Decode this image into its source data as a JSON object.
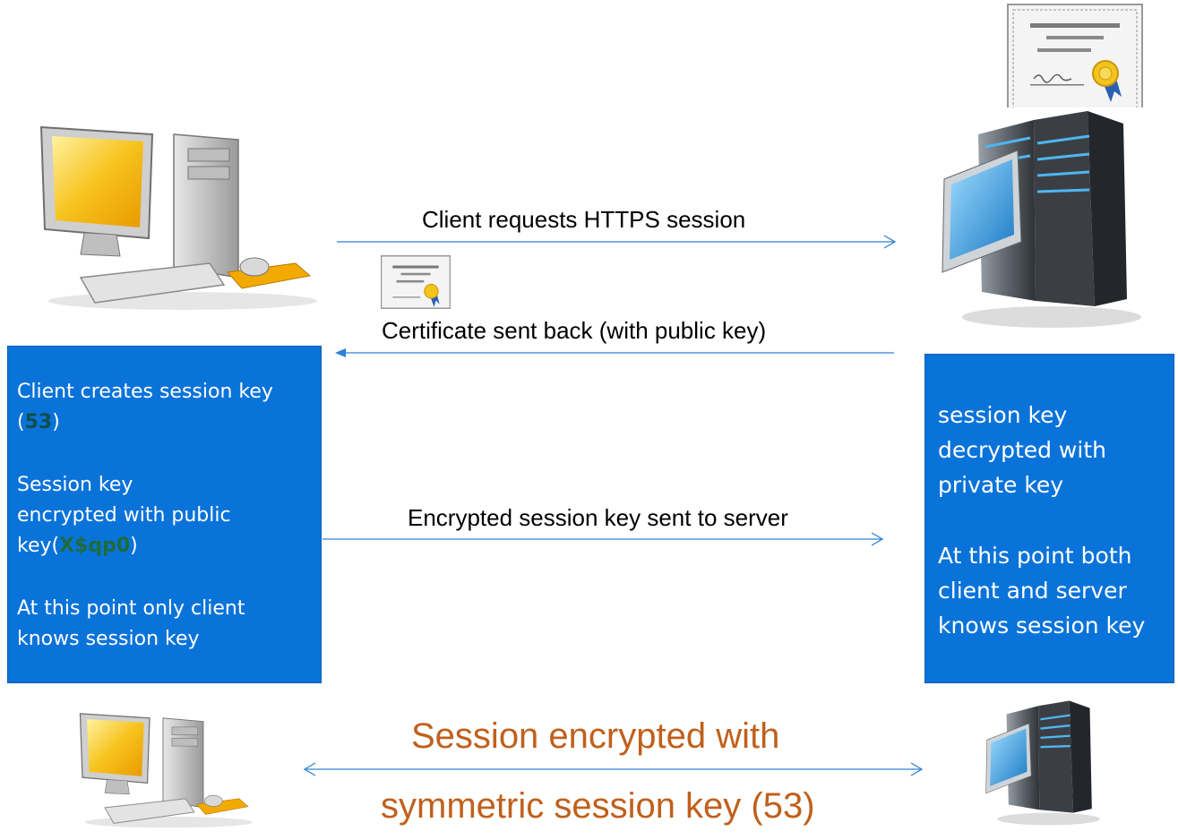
{
  "messages": {
    "request": "Client requests HTTPS session",
    "certificate": "Certificate sent back (with public key)",
    "encrypted_key": "Encrypted session key sent to server"
  },
  "client_box": {
    "line1": "Client creates session key",
    "key_open": "(",
    "key_value": "53",
    "key_close": ")",
    "line3": "Session key",
    "line4": "encrypted with public",
    "enc_prefix": "key(",
    "enc_value": "X$qp0",
    "enc_close": ")",
    "line6": "At this point only client",
    "line7": "knows session key"
  },
  "server_box": {
    "line1": "session key",
    "line2": "decrypted with",
    "line3": "private key",
    "line4": "At this point both",
    "line5": "client and server",
    "line6": "knows session key"
  },
  "final": {
    "line1": "Session  encrypted with",
    "line2": "symmetric session key (53)"
  },
  "colors": {
    "box": "#0a73d9",
    "arrow": "#2f80d6",
    "final_text": "#c0601c",
    "key_highlight": "#0d4f4a"
  },
  "icons": [
    "desktop-computer-icon",
    "server-tower-icon",
    "certificate-icon"
  ]
}
